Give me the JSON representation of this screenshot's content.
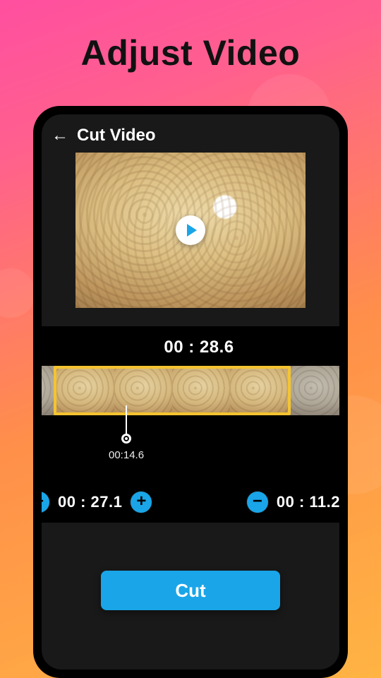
{
  "headline": "Adjust Video",
  "appbar": {
    "title": "Cut Video"
  },
  "trim": {
    "total_time": "00 : 28.6",
    "playhead_time": "00:14.6",
    "start_time": "00 : 27.1",
    "end_time": "00 : 11.2"
  },
  "buttons": {
    "cut": "Cut",
    "minus": "−",
    "plus": "+"
  },
  "colors": {
    "accent": "#1aa5e8",
    "selection": "#f4c430"
  }
}
